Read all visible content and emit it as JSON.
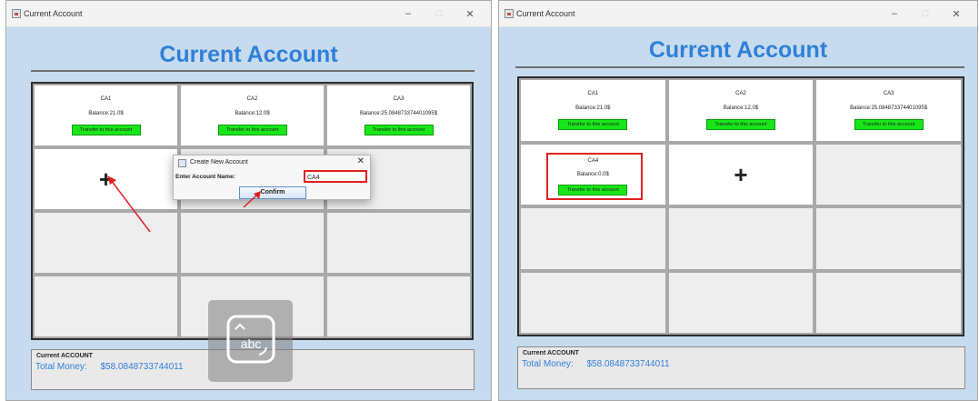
{
  "left_window": {
    "title": "Current Account",
    "controls": [
      "–",
      "□",
      "✕"
    ],
    "heading": "Current Account",
    "accounts": [
      {
        "name": "CA1",
        "balance": "Balance:21.0$",
        "button": "Transfer to this account"
      },
      {
        "name": "CA2",
        "balance": "Balance:12.0$",
        "button": "Transfer to this account"
      },
      {
        "name": "CA3",
        "balance": "Balance:25.084873374401095$",
        "button": "Transfer to this account"
      }
    ],
    "add_symbol": "+",
    "dialog": {
      "title": "Create New Account",
      "close": "✕",
      "label": "Enter Account Name:",
      "input_value": "CA4",
      "confirm": "Confirm"
    },
    "footer": {
      "title": "Current ACCOUNT",
      "money_label": "Total Money:",
      "money_value": "$58.0848733744011"
    },
    "keyboard_icon_text": "abc"
  },
  "right_window": {
    "title": "Current Account",
    "controls": [
      "–",
      "□",
      "✕"
    ],
    "heading": "Current Account",
    "accounts": [
      {
        "name": "CA1",
        "balance": "Balance:21.0$",
        "button": "Transfer to this account"
      },
      {
        "name": "CA2",
        "balance": "Balance:12.0$",
        "button": "Transfer to this account"
      },
      {
        "name": "CA3",
        "balance": "Balance:25.084873374401095$",
        "button": "Transfer to this account"
      },
      {
        "name": "CA4",
        "balance": "Balance:0.0$",
        "button": "Transfer to this account"
      }
    ],
    "add_symbol": "+",
    "footer": {
      "title": "Current ACCOUNT",
      "money_label": "Total Money:",
      "money_value": "$58.0848733744011"
    }
  },
  "colors": {
    "accent": "#2f7fd8",
    "transfer_button": "#19e619",
    "annotation": "#e02020",
    "window_bg": "#c6dcee"
  }
}
